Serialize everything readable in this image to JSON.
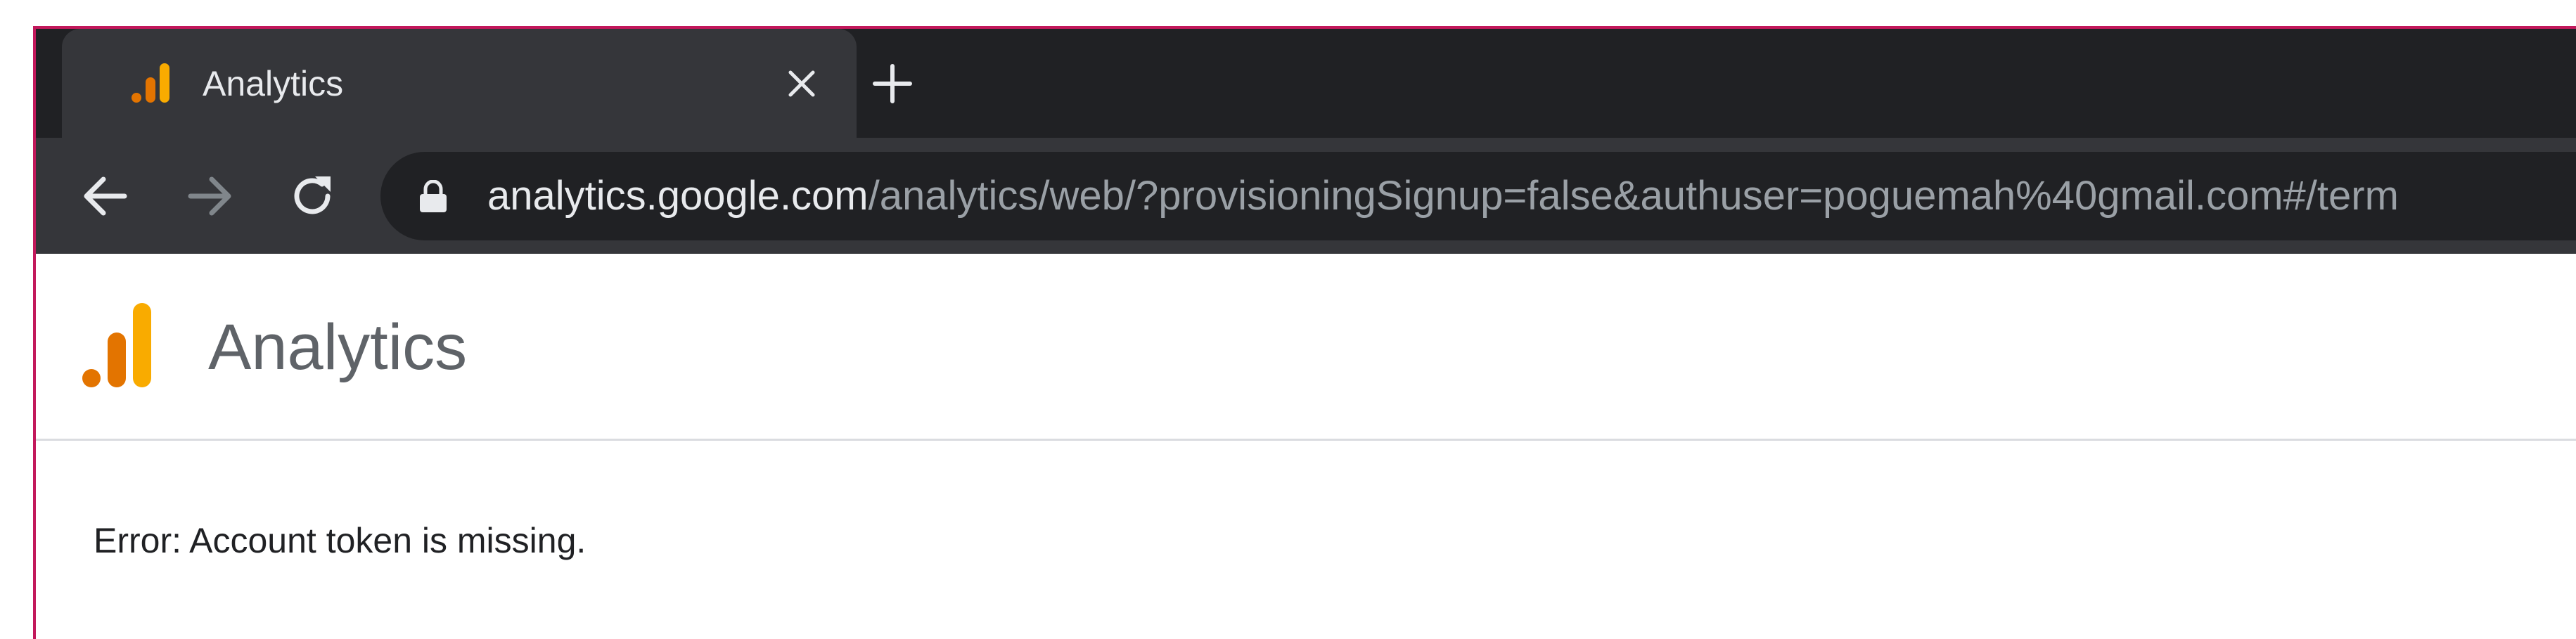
{
  "browser": {
    "tab": {
      "title": "Analytics",
      "favicon": "google-analytics-icon",
      "close_icon": "close-icon"
    },
    "new_tab_icon": "plus-icon",
    "nav": {
      "back_icon": "arrow-back-icon",
      "forward_icon": "arrow-forward-icon",
      "reload_icon": "reload-icon"
    },
    "address_bar": {
      "lock_icon": "lock-icon",
      "host": "analytics.google.com",
      "path": "/analytics/web/?provisioningSignup=false&authuser=poguemah%40gmail.com#/term"
    }
  },
  "page": {
    "logo": "google-analytics-logo",
    "product_name": "Analytics",
    "error_message": "Error: Account token is missing."
  },
  "colors": {
    "frame_border": "#c2185b",
    "tabstrip_bg": "#202124",
    "active_tab_bg": "#35363a",
    "logo_orange_dark": "#e37400",
    "logo_orange_light": "#f9ab00",
    "header_text": "#5f6368"
  }
}
